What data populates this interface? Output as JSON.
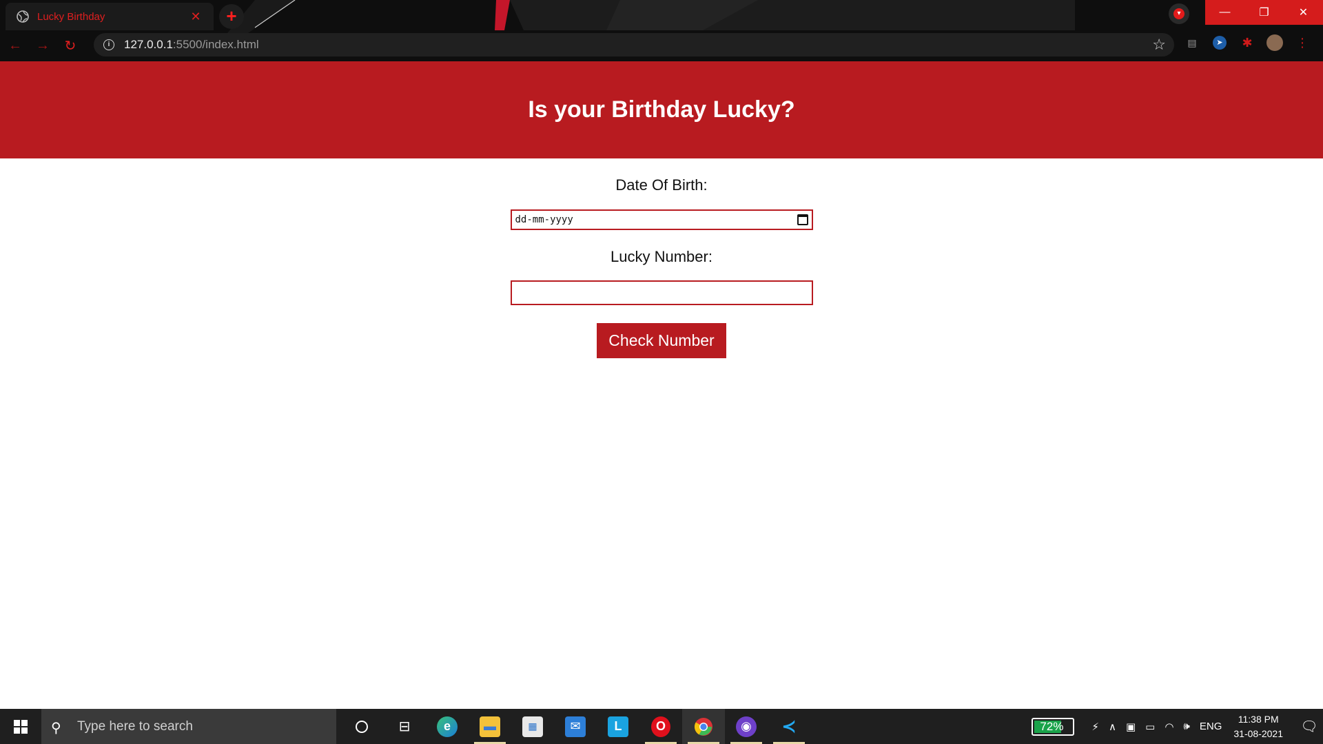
{
  "browser": {
    "tab_title": "Lucky Birthday",
    "tab_close": "✕",
    "new_tab": "+",
    "url_host": "127.0.0.1",
    "url_path": ":5500/index.html",
    "window_controls": {
      "minimize": "—",
      "restore": "❐",
      "close": "✕"
    }
  },
  "page": {
    "heading": "Is your Birthday Lucky?",
    "dob_label": "Date Of Birth:",
    "dob_placeholder": "dd-mm-yyyy",
    "lucky_label": "Lucky Number:",
    "lucky_value": "",
    "check_button": "Check Number"
  },
  "taskbar": {
    "search_placeholder": "Type here to search",
    "battery": "72%",
    "language": "ENG",
    "time": "11:38 PM",
    "date": "31-08-2021",
    "apps": [
      "cortana",
      "task-view",
      "edge",
      "file-explorer",
      "store",
      "mail",
      "app-l",
      "opera",
      "chrome",
      "github-desktop",
      "vscode"
    ]
  },
  "colors": {
    "accent": "#b81b20",
    "chrome_bg": "#101010",
    "taskbar_bg": "#1f1f1f"
  }
}
